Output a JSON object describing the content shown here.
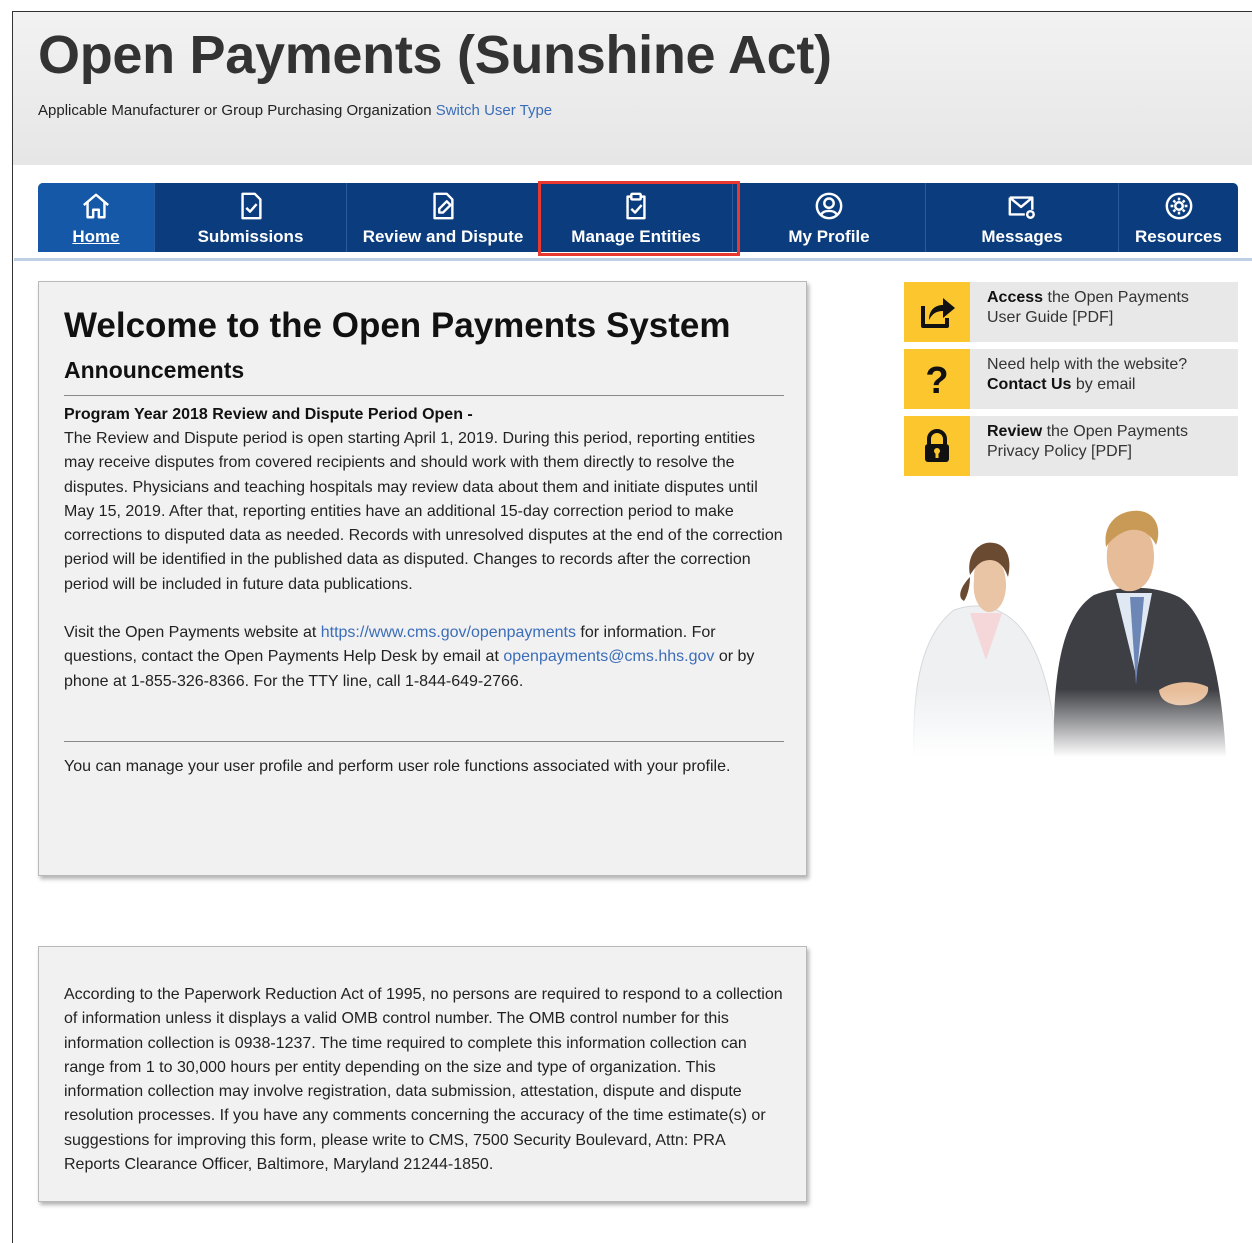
{
  "header": {
    "title": "Open Payments (Sunshine Act)",
    "user_type": "Applicable Manufacturer or Group Purchasing Organization",
    "switch_link": "Switch User Type"
  },
  "nav": {
    "items": [
      {
        "label": "Home",
        "icon": "home-icon",
        "active": true
      },
      {
        "label": "Submissions",
        "icon": "document-check-icon"
      },
      {
        "label": "Review and Dispute",
        "icon": "document-edit-icon"
      },
      {
        "label": "Manage Entities",
        "icon": "clipboard-check-icon",
        "highlighted": true
      },
      {
        "label": "My Profile",
        "icon": "user-circle-icon"
      },
      {
        "label": "Messages",
        "icon": "envelope-icon"
      },
      {
        "label": "Resources",
        "icon": "gear-icon"
      }
    ],
    "highlight_color": "#e8382f",
    "bar_color": "#0b3d7e"
  },
  "main": {
    "welcome_title": "Welcome to the Open Payments System",
    "announcements_heading": "Announcements",
    "announcement_title": "Program Year 2018 Review and Dispute Period Open -",
    "announcement_body": "The Review and Dispute period is open starting April 1, 2019. During this period, reporting entities may receive disputes from covered recipients and should work with them directly to resolve the disputes. Physicians and teaching hospitals may review data about them and initiate disputes until May 15, 2019. After that, reporting entities have an additional 15-day correction period to make corrections to disputed data as needed. Records with unresolved disputes at the end of the correction period will be identified in the published data as disputed. Changes to records after the correction period will be included in future data publications.",
    "visit_prefix": "Visit the Open Payments website at",
    "website_link": "https://www.cms.gov/openpayments",
    "visit_middle": "for information. For questions, contact the Open Payments Help Desk by email at",
    "email_link": "openpayments@cms.hhs.gov",
    "visit_suffix": "or by phone at 1-855-326-8366. For the TTY line, call 1-844-649-2766.",
    "profile_text": "You can manage your user profile and perform user role functions associated with your profile."
  },
  "pra": {
    "text": "According to the Paperwork Reduction Act of 1995, no persons are required to respond to a collection of information unless it displays a valid OMB control number. The OMB control number for this information collection is 0938-1237. The time required to complete this information collection can range from 1 to 30,000 hours per entity depending on the size and type of organization. This information collection may involve registration, data submission, attestation, dispute and dispute resolution processes. If you have any comments concerning the accuracy of the time estimate(s) or suggestions for improving this form, please write to CMS, 7500 Security Boulevard, Attn: PRA Reports Clearance Officer, Baltimore, Maryland 21244-1850."
  },
  "sidebar": {
    "items": [
      {
        "icon": "share-arrow-icon",
        "bold": "Access",
        "line1_rest": " the Open Payments",
        "line2": "User Guide [PDF]"
      },
      {
        "icon": "question-mark-icon",
        "line1": "Need help with the website?",
        "bold": "Contact Us",
        "line2_rest": " by email"
      },
      {
        "icon": "lock-icon",
        "bold": "Review",
        "line1_rest": " the Open Payments",
        "line2": "Privacy Policy [PDF]"
      }
    ],
    "icon_bg": "#fbc62e"
  }
}
